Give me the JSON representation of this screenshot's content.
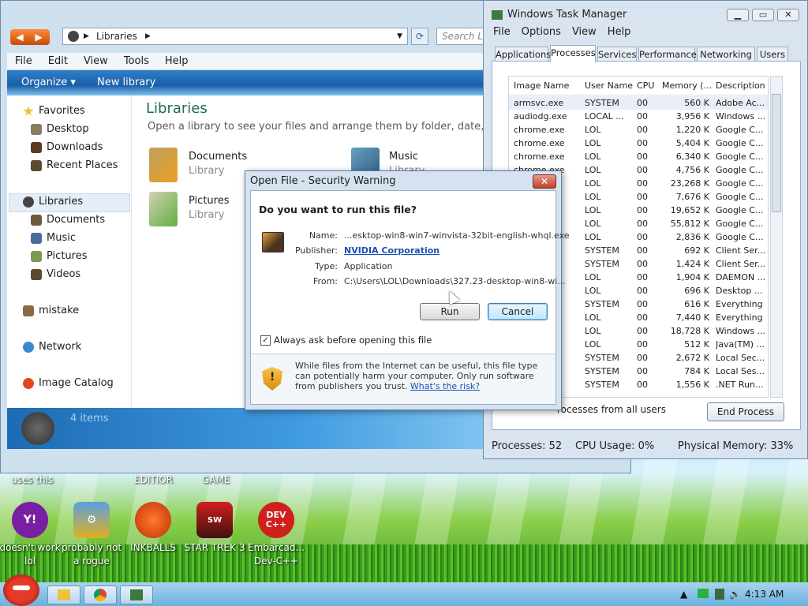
{
  "explorer": {
    "address_segments": [
      "Libraries"
    ],
    "search_placeholder": "Search Li",
    "menu": [
      "File",
      "Edit",
      "View",
      "Tools",
      "Help"
    ],
    "commands": {
      "organize": "Organize",
      "new_library": "New library"
    },
    "nav": {
      "favorites": "Favorites",
      "desktop": "Desktop",
      "downloads": "Downloads",
      "recent_places": "Recent Places",
      "libraries": "Libraries",
      "documents": "Documents",
      "music": "Music",
      "pictures": "Pictures",
      "videos": "Videos",
      "mistake": "mistake",
      "network": "Network",
      "image_catalog": "Image Catalog"
    },
    "title": "Libraries",
    "subtitle": "Open a library to see your files and arrange them by folder, date, and ot",
    "libraries": [
      {
        "name": "Documents",
        "type": "Library"
      },
      {
        "name": "Music",
        "type": "Library"
      },
      {
        "name": "Pictures",
        "type": "Library"
      }
    ],
    "status": "4 items"
  },
  "desktop": {
    "top_labels": [
      "uses this",
      "EDITIOR",
      "GAME"
    ],
    "icons": [
      {
        "label": "doesn't work lol"
      },
      {
        "label": "probably not a rogue"
      },
      {
        "label": "INKBALLS"
      },
      {
        "label": "STAR TREK 3"
      },
      {
        "label": "Embarcad... Dev-C++"
      }
    ],
    "devcpp_badge": "DEV C++"
  },
  "task_manager": {
    "title": "Windows Task Manager",
    "menu": [
      "File",
      "Options",
      "View",
      "Help"
    ],
    "tabs": [
      "Applications",
      "Processes",
      "Services",
      "Performance",
      "Networking",
      "Users"
    ],
    "columns": [
      "Image Name",
      "User Name",
      "CPU",
      "Memory (...",
      "Description"
    ],
    "rows": [
      {
        "name": "armsvc.exe",
        "user": "SYSTEM",
        "cpu": "00",
        "mem": "560 K",
        "desc": "Adobe Ac..."
      },
      {
        "name": "audiodg.exe",
        "user": "LOCAL ...",
        "cpu": "00",
        "mem": "3,956 K",
        "desc": "Windows ..."
      },
      {
        "name": "chrome.exe",
        "user": "LOL",
        "cpu": "00",
        "mem": "1,220 K",
        "desc": "Google C..."
      },
      {
        "name": "chrome.exe",
        "user": "LOL",
        "cpu": "00",
        "mem": "5,404 K",
        "desc": "Google C..."
      },
      {
        "name": "chrome.exe",
        "user": "LOL",
        "cpu": "00",
        "mem": "6,340 K",
        "desc": "Google C..."
      },
      {
        "name": "chrome.exe",
        "user": "LOL",
        "cpu": "00",
        "mem": "4,756 K",
        "desc": "Google C..."
      },
      {
        "name": "",
        "user": "LOL",
        "cpu": "00",
        "mem": "23,268 K",
        "desc": "Google C..."
      },
      {
        "name": "",
        "user": "LOL",
        "cpu": "00",
        "mem": "7,676 K",
        "desc": "Google C..."
      },
      {
        "name": "",
        "user": "LOL",
        "cpu": "00",
        "mem": "19,652 K",
        "desc": "Google C..."
      },
      {
        "name": "",
        "user": "LOL",
        "cpu": "00",
        "mem": "55,812 K",
        "desc": "Google C..."
      },
      {
        "name": "",
        "user": "LOL",
        "cpu": "00",
        "mem": "2,836 K",
        "desc": "Google C..."
      },
      {
        "name": "",
        "user": "SYSTEM",
        "cpu": "00",
        "mem": "692 K",
        "desc": "Client Ser..."
      },
      {
        "name": "",
        "user": "SYSTEM",
        "cpu": "00",
        "mem": "1,424 K",
        "desc": "Client Ser..."
      },
      {
        "name": "xe",
        "user": "LOL",
        "cpu": "00",
        "mem": "1,904 K",
        "desc": "DAEMON ..."
      },
      {
        "name": "",
        "user": "LOL",
        "cpu": "00",
        "mem": "696 K",
        "desc": "Desktop ..."
      },
      {
        "name": "xe",
        "user": "SYSTEM",
        "cpu": "00",
        "mem": "616 K",
        "desc": "Everything"
      },
      {
        "name": "xe",
        "user": "LOL",
        "cpu": "00",
        "mem": "7,440 K",
        "desc": "Everything"
      },
      {
        "name": "",
        "user": "LOL",
        "cpu": "00",
        "mem": "18,728 K",
        "desc": "Windows ..."
      },
      {
        "name": "",
        "user": "LOL",
        "cpu": "00",
        "mem": "512 K",
        "desc": "Java(TM) ..."
      },
      {
        "name": "",
        "user": "SYSTEM",
        "cpu": "00",
        "mem": "2,672 K",
        "desc": "Local Sec..."
      },
      {
        "name": "",
        "user": "SYSTEM",
        "cpu": "00",
        "mem": "784 K",
        "desc": "Local Ses..."
      },
      {
        "name": "e",
        "user": "SYSTEM",
        "cpu": "00",
        "mem": "1,556 K",
        "desc": ".NET Run..."
      }
    ],
    "show_all": "rocesses from all users",
    "end_process": "End Process",
    "status": {
      "processes": "Processes: 52",
      "cpu": "CPU Usage: 0%",
      "memory": "Physical Memory: 33%"
    }
  },
  "dialog": {
    "title": "Open File - Security Warning",
    "question": "Do you want to run this file?",
    "name_label": "Name:",
    "name_value": "...esktop-win8-win7-winvista-32bit-english-whql.exe",
    "publisher_label": "Publisher:",
    "publisher_value": "NVIDIA Corporation",
    "type_label": "Type:",
    "type_value": "Application",
    "from_label": "From:",
    "from_value": "C:\\Users\\LOL\\Downloads\\327.23-desktop-win8-wi...",
    "run": "Run",
    "cancel": "Cancel",
    "always_ask": "Always ask before opening this file",
    "warning_text": "While files from the Internet can be useful, this file type can potentially harm your computer. Only run software from publishers you trust.",
    "risk_link": "What's the risk?"
  },
  "taskbar": {
    "clock": "4:13 AM"
  }
}
